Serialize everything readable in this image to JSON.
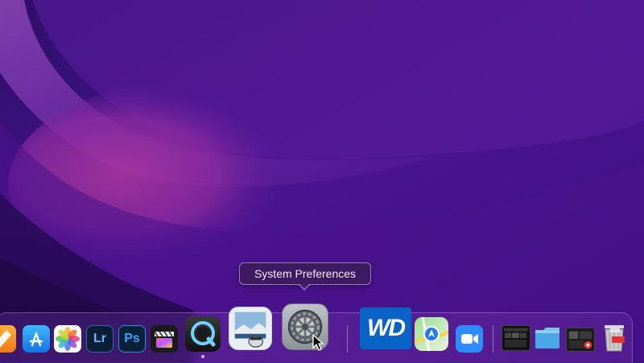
{
  "desktop": {
    "wallpaper": "purple-waves"
  },
  "tooltip": {
    "text": "System Preferences"
  },
  "dock": {
    "apps": [
      {
        "name": "pages",
        "icon": "pages-icon"
      },
      {
        "name": "app-store",
        "icon": "app-store-icon"
      },
      {
        "name": "photos",
        "icon": "photos-icon"
      },
      {
        "name": "lightroom",
        "icon": "lightroom-icon",
        "label": "Lr"
      },
      {
        "name": "photoshop",
        "icon": "photoshop-icon",
        "label": "Ps"
      },
      {
        "name": "final-cut-pro",
        "icon": "final-cut-pro-icon"
      },
      {
        "name": "quicktime-player",
        "icon": "quicktime-icon",
        "running": true
      },
      {
        "name": "preview",
        "icon": "preview-icon"
      },
      {
        "name": "system-preferences",
        "icon": "system-preferences-icon",
        "hovered": true
      }
    ],
    "recent_apps": [
      {
        "name": "wd",
        "icon": "wd-icon",
        "label": "WD"
      },
      {
        "name": "maps",
        "icon": "maps-icon"
      },
      {
        "name": "zoom",
        "icon": "zoom-icon"
      }
    ],
    "stacks": [
      {
        "name": "screenshot-stack-1",
        "icon": "screenshot-stack-icon"
      },
      {
        "name": "folder",
        "icon": "folder-icon"
      },
      {
        "name": "screenshot-stack-2",
        "icon": "screenshot-stack-icon"
      },
      {
        "name": "trash",
        "icon": "trash-icon"
      }
    ]
  },
  "colors": {
    "wallpaper_base": "#3f1180",
    "wave_light": "#8a3db5",
    "wave_pink": "#a62c9a",
    "dock_glass": "#7a3caa"
  }
}
